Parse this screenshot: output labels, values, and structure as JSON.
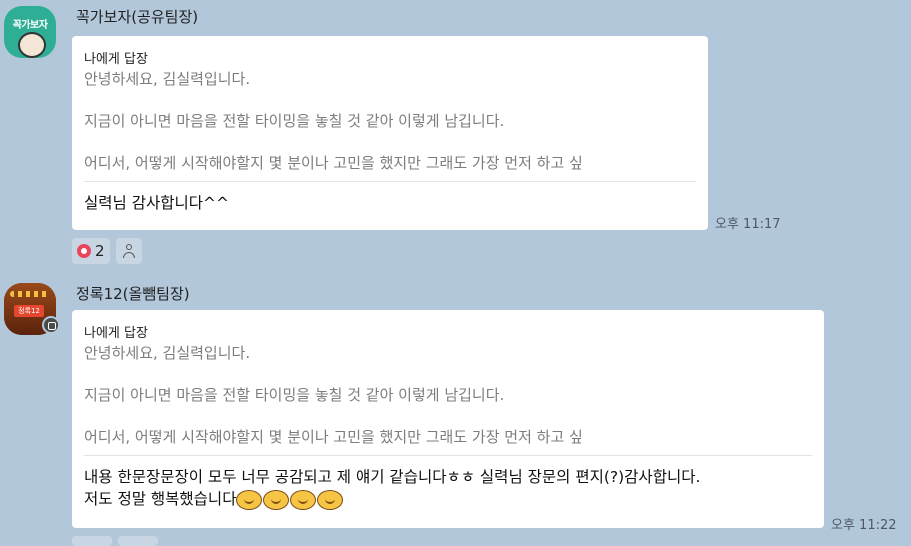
{
  "messages": [
    {
      "sender": "꼭가보자(공유팀장)",
      "avatar_text": "꼭가보자",
      "reply_title": "나에게 답장",
      "reply_lines": [
        "안녕하세요, 김실력입니다.",
        "지금이 아니면 마음을 전할 타이밍을 놓칠 것 같아 이렇게 남깁니다.",
        "어디서, 어떻게 시작해야할지 몇 분이나 고민을 했지만 그래도 가장 먼저 하고 싶"
      ],
      "text": "실력님 감사합니다^^",
      "time": "오후 11:17",
      "reaction_count": "2"
    },
    {
      "sender": "정록12(올뺌팀장)",
      "avatar_text": "정록12",
      "reply_title": "나에게 답장",
      "reply_lines": [
        "안녕하세요, 김실력입니다.",
        "지금이 아니면 마음을 전할 타이밍을 놓칠 것 같아 이렇게 남깁니다.",
        "어디서, 어떻게 시작해야할지 몇 분이나 고민을 했지만 그래도 가장 먼저 하고 싶"
      ],
      "text_line1": "내용 한문장문장이 모두 너무 공감되고 제 얘기 같습니다ㅎㅎ 실력님 장문의 편지(?)감사합니다.",
      "text_line2": "저도 정말 행복했습니다",
      "time": "오후 11:22"
    }
  ],
  "icons": {
    "heart": "heart-icon",
    "person": "person-icon",
    "emoji": "emoticon-icon"
  },
  "colors": {
    "background": "#b2c7da",
    "bubble": "#ffffff",
    "heart": "#e8445a"
  }
}
